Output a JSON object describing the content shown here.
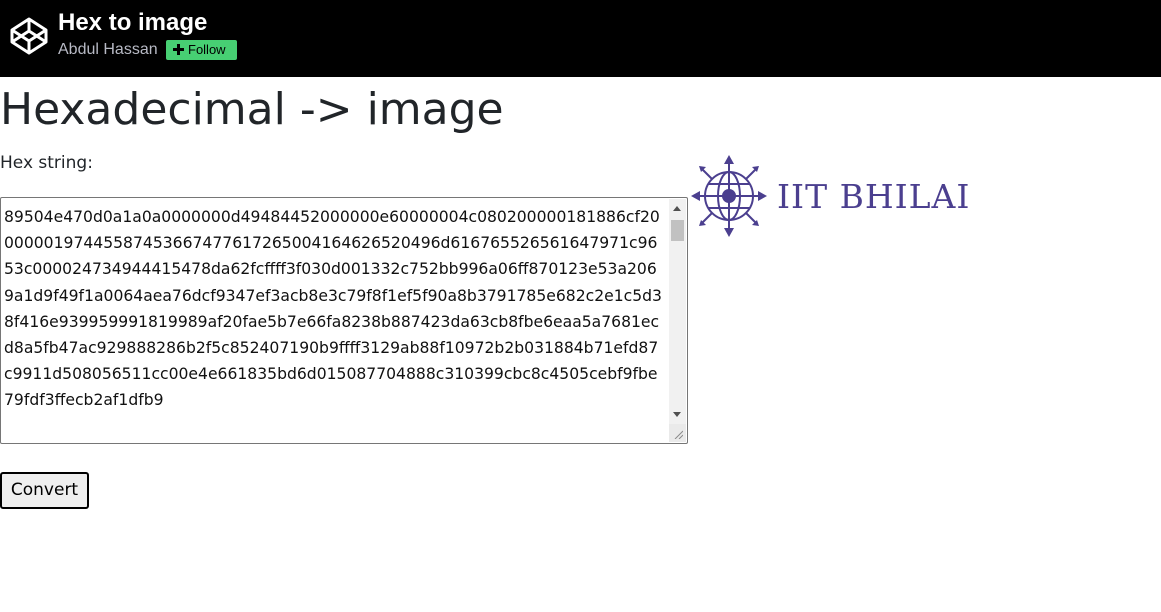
{
  "header": {
    "title": "Hex to image",
    "author": "Abdul Hassan",
    "follow_label": "Follow",
    "logo_icon": "codepen-logo-icon",
    "follow_color": "#47cf73"
  },
  "main": {
    "heading": "Hexadecimal -> image",
    "hex_label": "Hex string:",
    "hex_value": "89504e470d0a1a0a0000000d49484452000000e60000004c080200000181886cf2000000197445587453667477617265004164626520496d616765526561647971c9653c000024734944415478da62fcffff3f030d001332c752bb996a06ff870123e53a2069a1d9f49f1a0064aea76dcf9347ef3acb8e3c79f8f1ef5f90a8b3791785e682c2e1c5d38f416e939959991819989af20fae5b7e66fa8238b887423da63cb8fbe6eaa5a7681ecd8a5fb47ac929888286b2f5c852407190b9ffff3129ab88f10972b2b031884b71efd87c9911d508056511cc00e4e661835bd6d015087704888c310399cbc8c4505cebf9fbe79fdf3ffecb2af1dfb9",
    "convert_label": "Convert"
  },
  "logo_image": {
    "text": "IIT BHILAI",
    "color": "#4b3f8f"
  }
}
